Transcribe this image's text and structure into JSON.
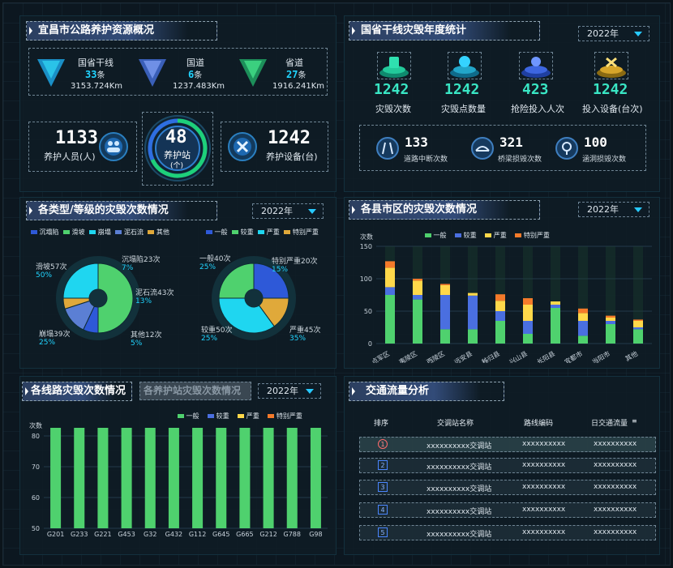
{
  "p1": {
    "title": "宜昌市公路养护资源概况",
    "roads": [
      {
        "name": "国省干线",
        "count": "33",
        "unit": "条",
        "length": "3153.724Km"
      },
      {
        "name": "国道",
        "count": "6",
        "unit": "条",
        "length": "1237.483Km"
      },
      {
        "name": "省道",
        "count": "27",
        "unit": "条",
        "length": "1916.241Km"
      }
    ],
    "staff": {
      "value": "1133",
      "label": "养护人员(人)"
    },
    "station": {
      "value": "48",
      "label": "养护站",
      "unit": "(个)"
    },
    "equip": {
      "value": "1242",
      "label": "养护设备(台)"
    }
  },
  "p2": {
    "title": "国省干线灾毁年度统计",
    "year": "2022年",
    "stats": [
      {
        "value": "1242",
        "label": "灾毁次数"
      },
      {
        "value": "1242",
        "label": "灾毁点数量"
      },
      {
        "value": "423",
        "label": "抢险投入人次"
      },
      {
        "value": "1242",
        "label": "投入设备(台次)"
      }
    ],
    "sub": [
      {
        "value": "133",
        "label": "道路中断次数"
      },
      {
        "value": "321",
        "label": "桥梁损毁次数"
      },
      {
        "value": "100",
        "label": "涵洞损毁次数"
      }
    ]
  },
  "p3": {
    "title": "各类型/等级的灾毁次数情况",
    "year": "2022年",
    "legend1": [
      "沉塌陷",
      "滑坡",
      "崩塌",
      "泥石流",
      "其他"
    ],
    "legend2": [
      "一般",
      "较重",
      "严重",
      "特别严重"
    ],
    "pie1": {
      "labels": [
        {
          "name": "滑坡57次",
          "pct": "50%"
        },
        {
          "name": "沉塌陷23次",
          "pct": "7%"
        },
        {
          "name": "泥石流43次",
          "pct": "13%"
        },
        {
          "name": "其他12次",
          "pct": "5%"
        },
        {
          "name": "崩塌39次",
          "pct": "25%"
        }
      ]
    },
    "pie2": {
      "labels": [
        {
          "name": "一般40次",
          "pct": "25%"
        },
        {
          "name": "特别严重20次",
          "pct": "15%"
        },
        {
          "name": "严重45次",
          "pct": "35%"
        },
        {
          "name": "较重50次",
          "pct": "25%"
        }
      ]
    }
  },
  "p4": {
    "title": "各县市区的灾毁次数情况",
    "year": "2022年",
    "legend": [
      "一般",
      "较重",
      "严重",
      "特别严重"
    ],
    "yunit": "次数"
  },
  "p5": {
    "tab1": "各线路灾毁次数情况",
    "tab2": "各养护站灾毁次数情况",
    "year": "2022年",
    "legend": [
      "一般",
      "较重",
      "严重",
      "特别严重"
    ],
    "yunit": "次数"
  },
  "p6": {
    "title": "交通流量分析",
    "headers": [
      "排序",
      "交调站名称",
      "路线编码",
      "日交通流量"
    ],
    "rows": [
      {
        "rank": "1",
        "name": "xxxxxxxxxx交调站",
        "code": "xxxxxxxxxx",
        "flow": "xxxxxxxxxx"
      },
      {
        "rank": "2",
        "name": "xxxxxxxxxx交调站",
        "code": "xxxxxxxxxx",
        "flow": "xxxxxxxxxx"
      },
      {
        "rank": "3",
        "name": "xxxxxxxxxx交调站",
        "code": "xxxxxxxxxx",
        "flow": "xxxxxxxxxx"
      },
      {
        "rank": "4",
        "name": "xxxxxxxxxx交调站",
        "code": "xxxxxxxxxx",
        "flow": "xxxxxxxxxx"
      },
      {
        "rank": "5",
        "name": "xxxxxxxxxx交调站",
        "code": "xxxxxxxxxx",
        "flow": "xxxxxxxxxx"
      }
    ]
  },
  "colors": {
    "general": "#4fd16e",
    "heavy": "#4a6fe0",
    "severe": "#ffd84a",
    "extreme": "#f47a2a",
    "cyan": "#21d4ff"
  },
  "chart_data": [
    {
      "type": "bar",
      "stacked": true,
      "ylabel": "次数",
      "ylim": [
        0,
        150
      ],
      "yticks": [
        0,
        50,
        100,
        150
      ],
      "categories": [
        "点军区",
        "夷陵区",
        "西陵区",
        "远安县",
        "秭归县",
        "兴山县",
        "长阳县",
        "宜都市",
        "当阳市",
        "其他"
      ],
      "series": [
        {
          "name": "一般",
          "values": [
            75,
            68,
            22,
            22,
            35,
            15,
            55,
            12,
            30,
            22
          ]
        },
        {
          "name": "较重",
          "values": [
            12,
            7,
            53,
            52,
            15,
            20,
            5,
            23,
            5,
            3
          ]
        },
        {
          "name": "严重",
          "values": [
            30,
            22,
            15,
            4,
            16,
            25,
            5,
            12,
            5,
            10
          ]
        },
        {
          "name": "特别严重",
          "values": [
            10,
            3,
            2,
            0,
            10,
            10,
            0,
            7,
            3,
            2
          ]
        }
      ]
    },
    {
      "type": "bar",
      "stacked": true,
      "ylabel": "次数",
      "ylim": [
        50,
        80
      ],
      "yticks": [
        50,
        60,
        70,
        80
      ],
      "categories": [
        "G201",
        "G233",
        "G221",
        "G453",
        "G32",
        "G432",
        "G112",
        "G645",
        "G665",
        "G212",
        "G788",
        "G98"
      ],
      "series": [
        {
          "name": "一般",
          "values": [
            55,
            53,
            63,
            66,
            58,
            68,
            55,
            53,
            55,
            56,
            53,
            55
          ]
        },
        {
          "name": "较重",
          "values": [
            11.5,
            5,
            2,
            2,
            0,
            2,
            11,
            3,
            2,
            2,
            1,
            3
          ]
        },
        {
          "name": "严重",
          "values": [
            1.5,
            3.5,
            1,
            6,
            5.5,
            8,
            5,
            6,
            1,
            1.5,
            2.5,
            2
          ]
        },
        {
          "name": "特别严重",
          "values": [
            0.5,
            1,
            0.5,
            0.5,
            1.5,
            2.5,
            1,
            1.5,
            0.5,
            0.5,
            0.5,
            0.5
          ]
        }
      ]
    },
    {
      "type": "pie",
      "title": "各类型",
      "labels": [
        "滑坡",
        "沉塌陷",
        "泥石流",
        "其他",
        "崩塌"
      ],
      "values": [
        50,
        7,
        13,
        5,
        25
      ]
    },
    {
      "type": "pie",
      "title": "各等级",
      "labels": [
        "一般",
        "特别严重",
        "严重",
        "较重"
      ],
      "values": [
        25,
        15,
        35,
        25
      ]
    }
  ]
}
